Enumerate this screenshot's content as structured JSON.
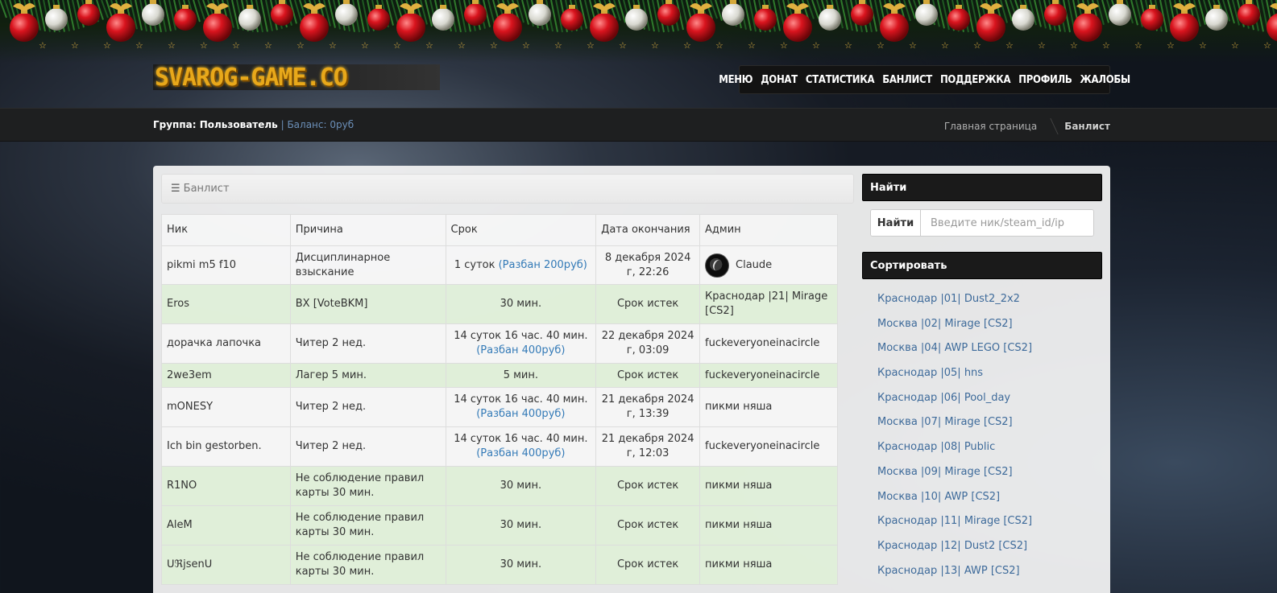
{
  "site": {
    "logo_text": "SVAROG-GAME.CO",
    "nav": [
      "МЕНЮ",
      "ДОНАТ",
      "СТАТИСТИКА",
      "БАНЛИСТ",
      "ПОДДЕРЖКА",
      "ПРОФИЛЬ",
      "ЖАЛОБЫ"
    ]
  },
  "user": {
    "group": "Группа: Пользователь",
    "balance": "| Баланс: 0руб"
  },
  "breadcrumb": {
    "home": "Главная страница",
    "current": "Банлист"
  },
  "main": {
    "panel_title": "Банлист",
    "columns": {
      "nick": "Ник",
      "reason": "Причина",
      "term": "Срок",
      "end_date": "Дата окончания",
      "admin": "Админ"
    },
    "rows": [
      {
        "nick": "pikmi m5 f10",
        "reason": "Дисциплинарное взыскание",
        "term": "1 суток",
        "unban": "(Разбан 200руб)",
        "end": "8 декабря 2024 г, 22:26",
        "admin": "Claude",
        "avatar": true,
        "status": "active"
      },
      {
        "nick": "Eros",
        "reason": "BX [VoteBKM]",
        "term": "30 мин.",
        "unban": "",
        "end": "Срок истек",
        "admin": "Краснодар |21| Mirage [CS2]",
        "avatar": false,
        "status": "expired"
      },
      {
        "nick": "дорачка лапочка",
        "reason": "Читер 2 нед.",
        "term": "14 суток 16 час. 40 мин.",
        "unban": "(Разбан 400руб)",
        "end": "22 декабря 2024 г, 03:09",
        "admin": "fuckeveryoneinacircle",
        "avatar": false,
        "status": "active"
      },
      {
        "nick": "2we3em",
        "reason": "Лагер 5 мин.",
        "term": "5 мин.",
        "unban": "",
        "end": "Срок истек",
        "admin": "fuckeveryoneinacircle",
        "avatar": false,
        "status": "expired"
      },
      {
        "nick": "mONESY",
        "reason": "Читер 2 нед.",
        "term": "14 суток 16 час. 40 мин.",
        "unban": "(Разбан 400руб)",
        "end": "21 декабря 2024 г, 13:39",
        "admin": "пикми няша",
        "avatar": false,
        "status": "active"
      },
      {
        "nick": "Ich bin gestorben.",
        "reason": "Читер 2 нед.",
        "term": "14 суток 16 час. 40 мин.",
        "unban": "(Разбан 400руб)",
        "end": "21 декабря 2024 г, 12:03",
        "admin": "fuckeveryoneinacircle",
        "avatar": false,
        "status": "active"
      },
      {
        "nick": "R1NO",
        "reason": "Не соблюдение правил карты 30 мин.",
        "term": "30 мин.",
        "unban": "",
        "end": "Срок истек",
        "admin": "пикми няша",
        "avatar": false,
        "status": "expired"
      },
      {
        "nick": "AleM",
        "reason": "Не соблюдение правил карты 30 мин.",
        "term": "30 мин.",
        "unban": "",
        "end": "Срок истек",
        "admin": "пикми няша",
        "avatar": false,
        "status": "expired"
      },
      {
        "nick": "ᑌℜjsenᑌ",
        "reason": "Не соблюдение правил карты 30 мин.",
        "term": "30 мин.",
        "unban": "",
        "end": "Срок истек",
        "admin": "пикми няша",
        "avatar": false,
        "status": "expired"
      }
    ]
  },
  "sidebar": {
    "find_title": "Найти",
    "find_label": "Найти",
    "find_placeholder": "Введите ник/steam_id/ip",
    "sort_title": "Сортировать",
    "servers": [
      "Краснодар |01| Dust2_2x2",
      "Москва |02| Mirage [CS2]",
      "Москва |04| AWP LEGO [CS2]",
      "Краснодар |05| hns",
      "Краснодар |06| Pool_day",
      "Москва |07| Mirage [CS2]",
      "Краснодар |08| Public",
      "Москва |09| Mirage [CS2]",
      "Москва |10| AWP [CS2]",
      "Краснодар |11| Mirage [CS2]",
      "Краснодар |12| Dust2 [CS2]",
      "Краснодар |13| AWP [CS2]"
    ]
  },
  "colors": {
    "expired_row": "#dff0d8",
    "link": "#337ab7",
    "logo": "#e8a81a"
  }
}
